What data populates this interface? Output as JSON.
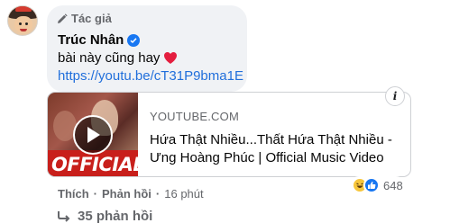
{
  "comment": {
    "role_label": "Tác giả",
    "author_name": "Trúc Nhân",
    "text": "bài này cũng hay",
    "link": "https://youtu.be/cT31P9bma1E"
  },
  "preview": {
    "domain": "YOUTUBE.COM",
    "title": "Hứa Thật Nhiều...Thất Hứa Thật Nhiều - Ưng Hoàng Phúc | Official Music Video",
    "thumbnail_text": "OFFICIAL"
  },
  "actions": {
    "like": "Thích",
    "reply": "Phản hồi",
    "separator": "·",
    "time": "16 phút"
  },
  "reactions": {
    "count": "648",
    "types": [
      "haha-icon",
      "like-icon"
    ]
  },
  "replies": {
    "label": "35 phản hồi"
  },
  "colors": {
    "link": "#216fdb",
    "bubble": "#f0f2f5",
    "secondary_text": "#65676b",
    "brand_blue": "#1877f2",
    "youtube_red": "#c81f1b"
  }
}
